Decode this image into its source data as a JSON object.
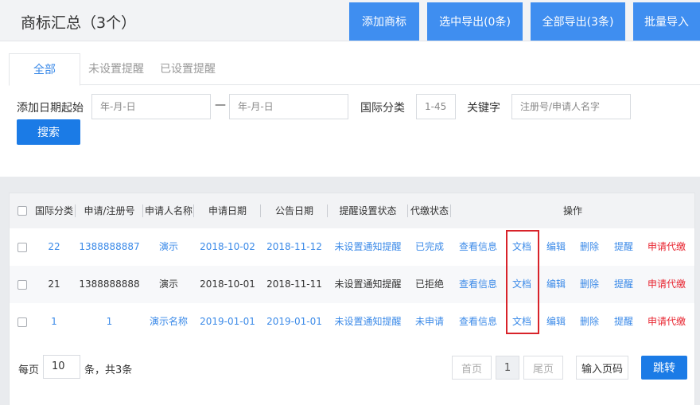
{
  "header": {
    "title": "商标汇总（3个）",
    "buttons": [
      "添加商标",
      "选中导出(0条)",
      "全部导出(3条)",
      "批量导入"
    ]
  },
  "tabs": [
    "全部",
    "未设置提醒",
    "已设置提醒"
  ],
  "filters": {
    "date_label": "添加日期起始",
    "date_from_placeholder": "年-月-日",
    "dash": "—",
    "date_to_placeholder": "年-月-日",
    "class_label": "国际分类",
    "class_placeholder": "1-45",
    "keyword_label": "关键字",
    "keyword_placeholder": "注册号/申请人名字",
    "search_label": "搜索"
  },
  "table": {
    "headers": [
      "国际分类",
      "申请/注册号",
      "申请人名称",
      "申请日期",
      "公告日期",
      "提醒设置状态",
      "代缴状态",
      "操作"
    ],
    "rows": [
      {
        "cls": "22",
        "no": "1388888887",
        "name": "演示",
        "apply": "2018-10-02",
        "pub": "2018-11-12",
        "remind": "未设置通知提醒",
        "pay": "已完成",
        "view": "查看信息",
        "doc": "文档",
        "edit": "编辑",
        "del": "删除",
        "alert": "提醒",
        "proxy": "申请代缴"
      },
      {
        "cls": "21",
        "no": "1388888888",
        "name": "演示",
        "apply": "2018-10-01",
        "pub": "2018-11-11",
        "remind": "未设置通知提醒",
        "pay": "已拒绝",
        "view": "查看信息",
        "doc": "文档",
        "edit": "编辑",
        "del": "删除",
        "alert": "提醒",
        "proxy": "申请代缴"
      },
      {
        "cls": "1",
        "no": "1",
        "name": "演示名称",
        "apply": "2019-01-01",
        "pub": "2019-01-01",
        "remind": "未设置通知提醒",
        "pay": "未申请",
        "view": "查看信息",
        "doc": "文档",
        "edit": "编辑",
        "del": "删除",
        "alert": "提醒",
        "proxy": "申请代缴"
      }
    ]
  },
  "pagination": {
    "per_page_label": "每页",
    "per_page_value": "10",
    "total_label": "条，共3条",
    "first_label": "首页",
    "current_page": "1",
    "last_label": "尾页",
    "goto_placeholder": "输入页码",
    "jump_label": "跳转"
  },
  "colors": {
    "primary": "#3f8ef0",
    "link": "#3b8ae8",
    "danger": "#e8242f",
    "highlight_box": "#d8232a"
  }
}
